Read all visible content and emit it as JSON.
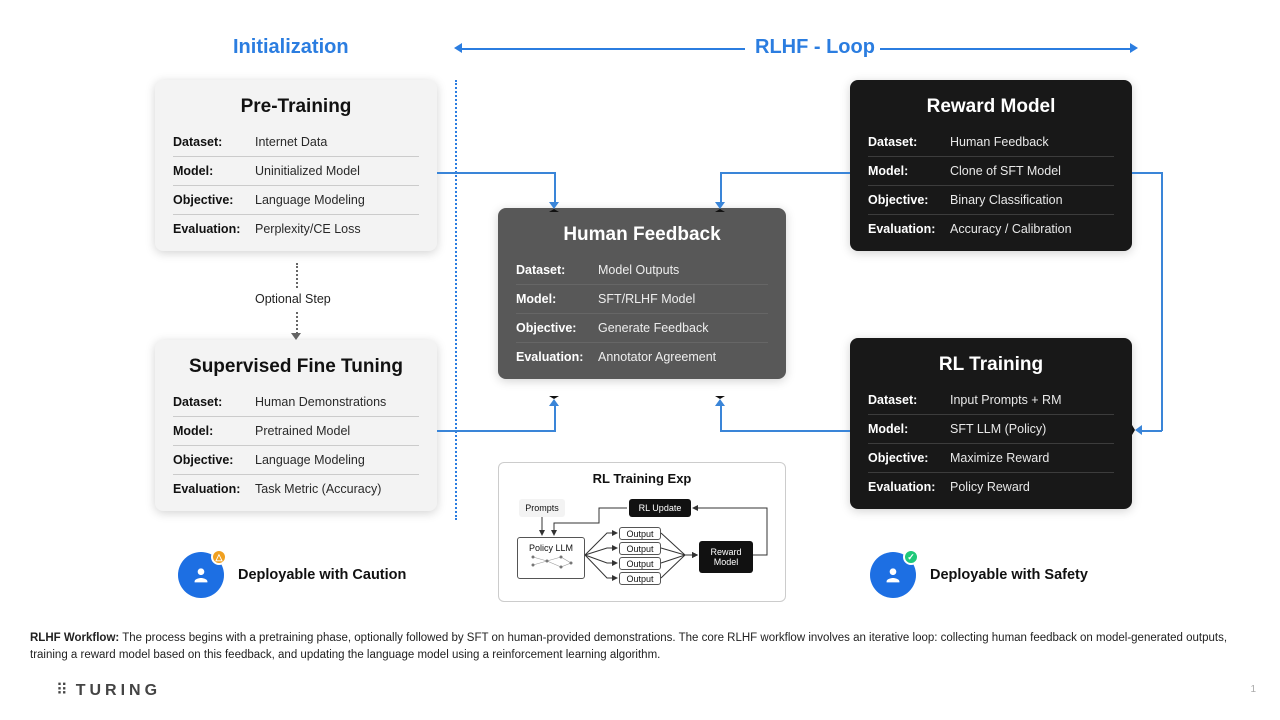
{
  "sections": {
    "init": "Initialization",
    "loop": "RLHF - Loop"
  },
  "cards": {
    "pre": {
      "title": "Pre-Training",
      "rows": [
        [
          "Dataset:",
          "Internet Data"
        ],
        [
          "Model:",
          "Uninitialized Model"
        ],
        [
          "Objective:",
          "Language Modeling"
        ],
        [
          "Evaluation:",
          "Perplexity/CE Loss"
        ]
      ]
    },
    "sft": {
      "title": "Supervised Fine Tuning",
      "rows": [
        [
          "Dataset:",
          "Human Demonstrations"
        ],
        [
          "Model:",
          "Pretrained Model"
        ],
        [
          "Objective:",
          "Language Modeling"
        ],
        [
          "Evaluation:",
          "Task Metric (Accuracy)"
        ]
      ]
    },
    "hf": {
      "title": "Human Feedback",
      "rows": [
        [
          "Dataset:",
          "Model Outputs"
        ],
        [
          "Model:",
          "SFT/RLHF  Model"
        ],
        [
          "Objective:",
          "Generate Feedback"
        ],
        [
          "Evaluation:",
          "Annotator Agreement"
        ]
      ]
    },
    "rm": {
      "title": "Reward Model",
      "rows": [
        [
          "Dataset:",
          "Human Feedback"
        ],
        [
          "Model:",
          "Clone of SFT Model"
        ],
        [
          "Objective:",
          "Binary Classification"
        ],
        [
          "Evaluation:",
          "Accuracy / Calibration"
        ]
      ]
    },
    "rl": {
      "title": "RL Training",
      "rows": [
        [
          "Dataset:",
          "Input Prompts + RM"
        ],
        [
          "Model:",
          "SFT LLM (Policy)"
        ],
        [
          "Objective:",
          "Maximize Reward"
        ],
        [
          "Evaluation:",
          "Policy Reward"
        ]
      ]
    }
  },
  "optional": "Optional Step",
  "mini": {
    "title": "RL Training Exp",
    "prompts": "Prompts",
    "policy": "Policy LLM",
    "update": "RL Update",
    "reward": "Reward\nModel",
    "output": "Output"
  },
  "badges": {
    "caution": "Deployable with Caution",
    "safety": "Deployable with Safety"
  },
  "footer": {
    "label": "RLHF Workflow:",
    "text": "The process begins with a pretraining phase, optionally followed by SFT on human-provided demonstrations. The core RLHF workflow involves an iterative loop: collecting human feedback on model-generated outputs, training a reward model based on this feedback, and updating the language model using a reinforcement learning algorithm."
  },
  "logo": "TURING",
  "pagenum": "1"
}
